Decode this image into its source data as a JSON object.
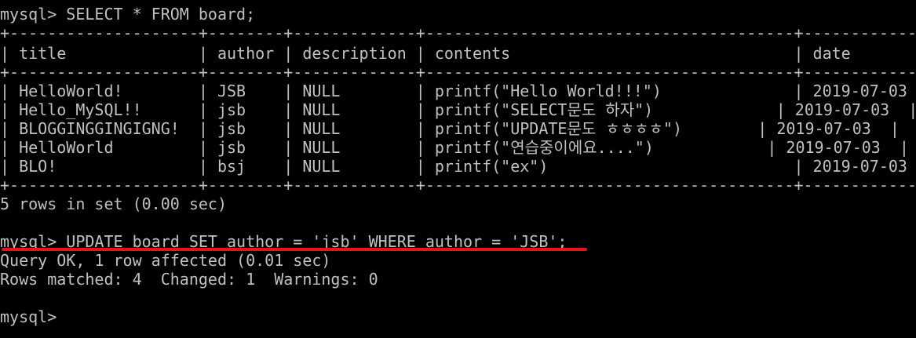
{
  "terminal": {
    "text_color": "#c0c0c0",
    "background": "#000000",
    "highlight_color": "#e8141c",
    "select_command": "mysql> SELECT * FROM board;",
    "table": {
      "border_top": "+--------------------+--------+-------------+---------------------------------------+-------------+",
      "header_row": "| title              | author | description | contents                              | date        |",
      "border_mid": "+--------------------+--------+-------------+---------------------------------------+-------------+",
      "rows": [
        "| HelloWorld!        | JSB    | NULL        | printf(\"Hello World!!!\")              | 2019-07-03  |",
        "| Hello_MySQL!!      | jsb    | NULL        | printf(\"SELECT문도 하자\")             | 2019-07-03  |",
        "| BLOGGINGGINGIGNG!  | jsb    | NULL        | printf(\"UPDATE문도 ㅎㅎㅎㅎ\")        | 2019-07-03  |",
        "| HelloWorld         | jsb    | NULL        | printf(\"연습중이에요....\")            | 2019-07-03  |",
        "| BLO!               | bsj    | NULL        | printf(\"ex\")                          | 2019-07-03  |"
      ],
      "border_bottom": "+--------------------+--------+-------------+---------------------------------------+-------------+"
    },
    "rows_in_set": "5 rows in set (0.00 sec)",
    "update_command": "mysql> UPDATE board SET author = 'jsb' WHERE author = 'JSB';",
    "query_ok": "Query OK, 1 row affected (0.01 sec)",
    "rows_matched": "Rows matched: 4  Changed: 1  Warnings: 0",
    "prompt": "mysql>"
  }
}
